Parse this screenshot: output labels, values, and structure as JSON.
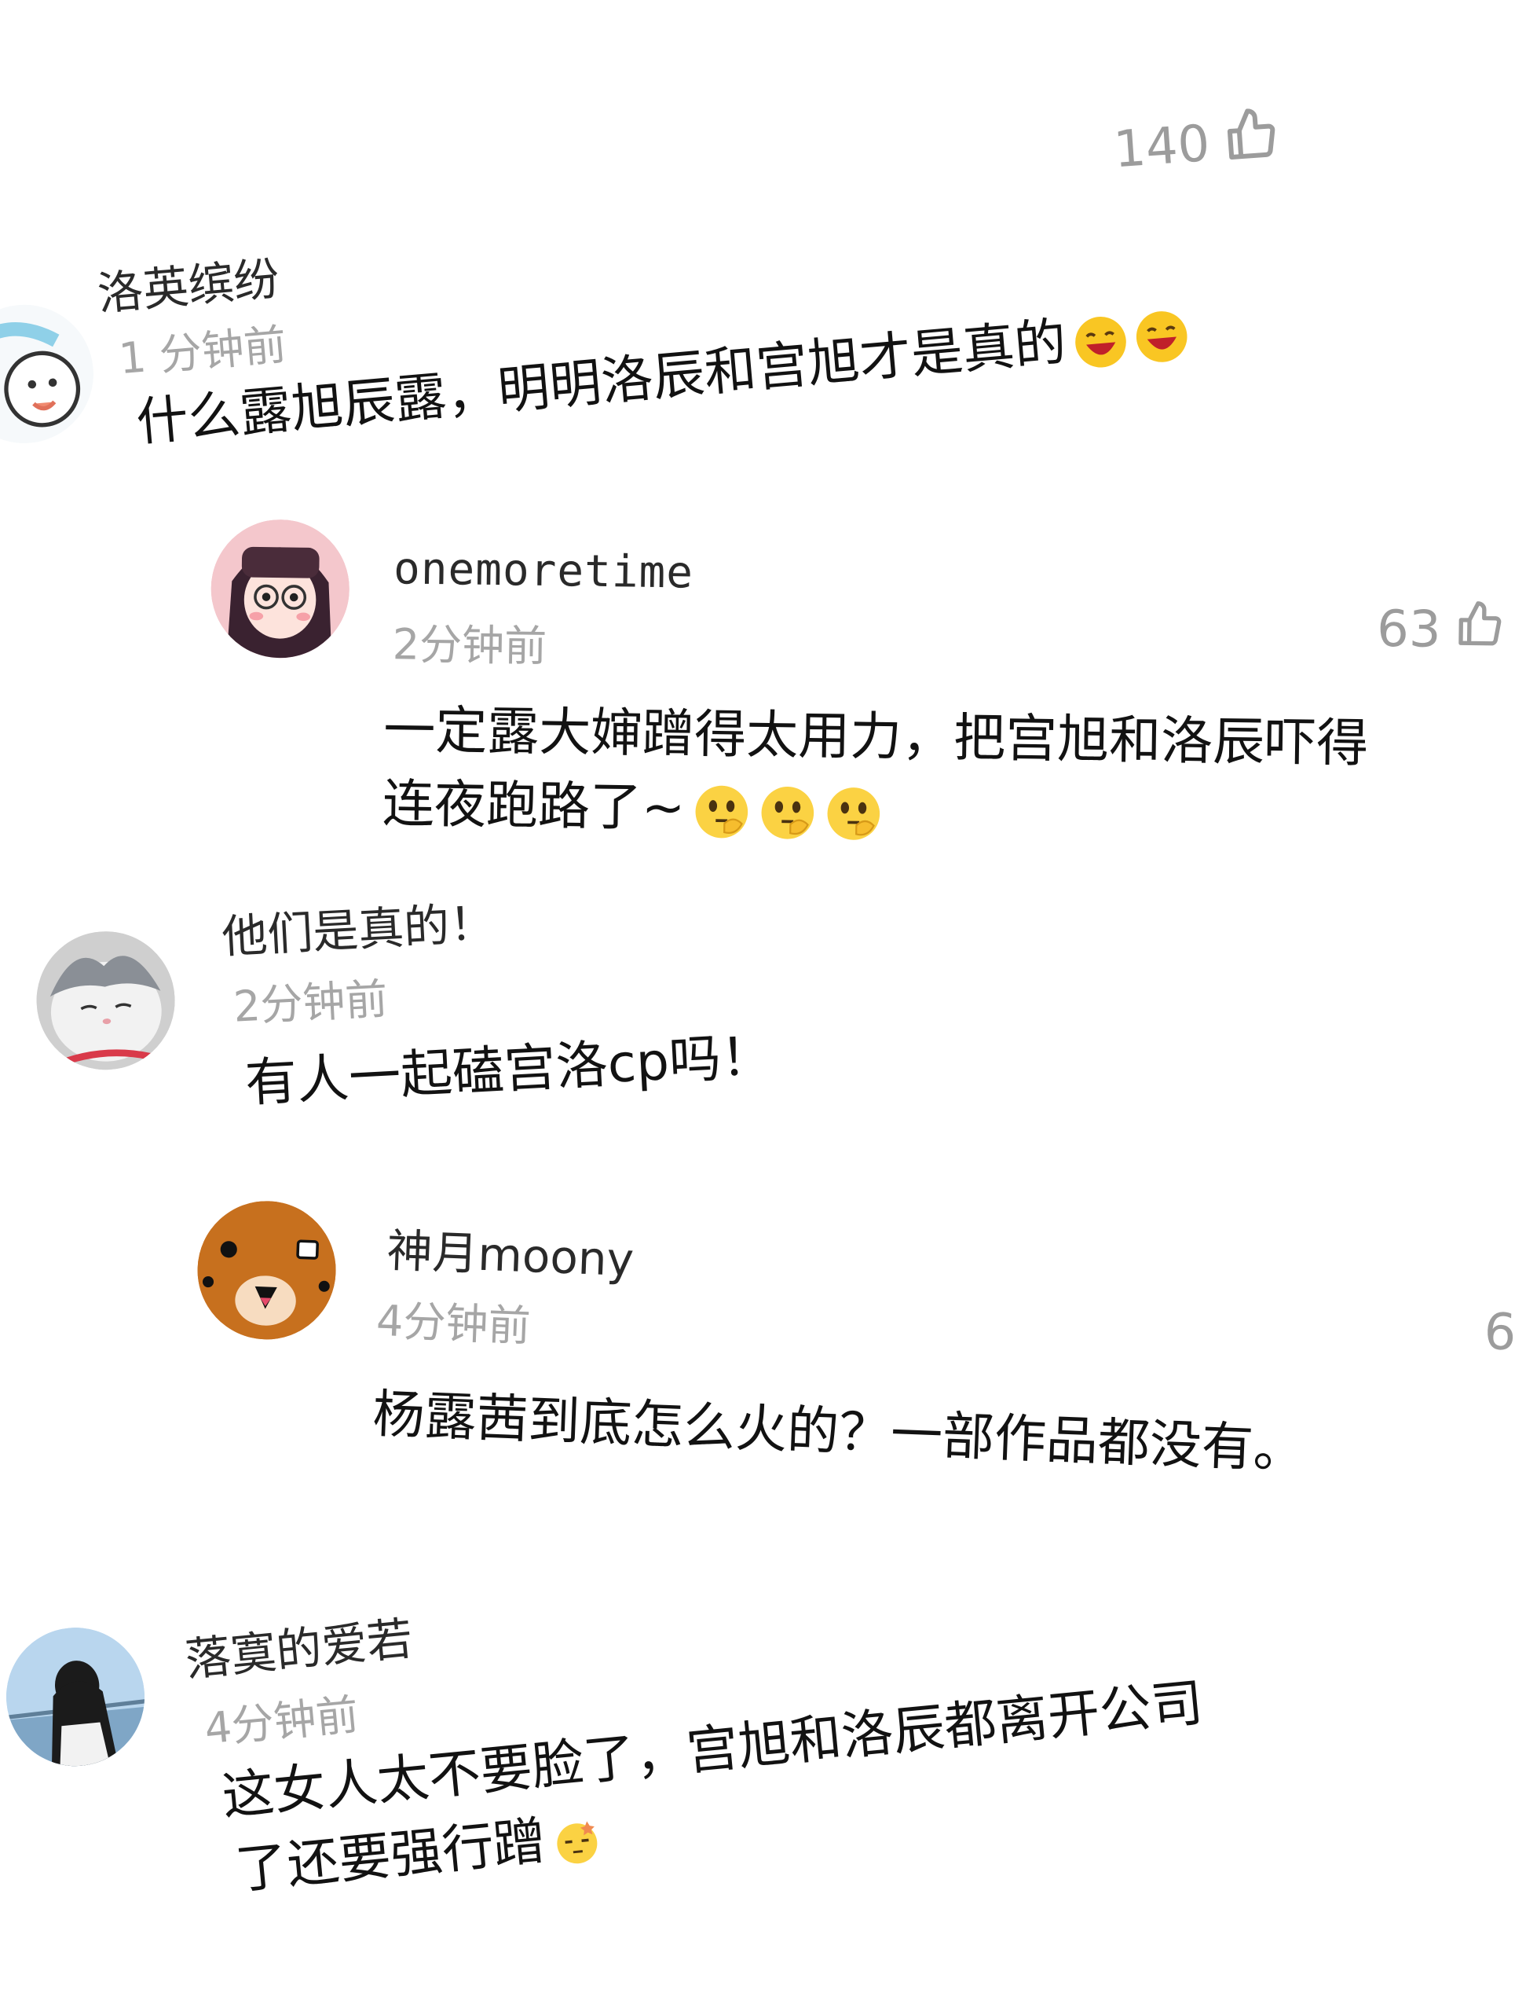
{
  "top": {
    "likes": "140"
  },
  "comments": [
    {
      "username": "洛英缤纷",
      "time": "1 分钟前",
      "text": "什么露旭辰露，明明洛辰和宫旭才是真的",
      "emojis": [
        "laughing-emoji",
        "laughing-emoji"
      ]
    },
    {
      "username": "onemoretime",
      "time": "2分钟前",
      "likes": "63",
      "text_line1": "一定露大婶蹭得太用力，把宫旭和洛辰吓得",
      "text_line2": "连夜跑路了~",
      "emojis": [
        "thinking-emoji",
        "thinking-emoji",
        "thinking-emoji"
      ]
    },
    {
      "username": "他们是真的！",
      "time": "2分钟前",
      "text": "有人一起磕宫洛cp吗！"
    },
    {
      "username": "神月moony",
      "time": "4分钟前",
      "likes": "6",
      "text": "杨露茜到底怎么火的？一部作品都没有。"
    },
    {
      "username": "落寞的爱若",
      "time": "4分钟前",
      "text_line1": "这女人太不要脸了，宫旭和洛辰都离开公司",
      "text_line2": "了还要强行蹭",
      "emojis": [
        "dizzy-emoji"
      ]
    }
  ],
  "colors": {
    "text": "#121212",
    "username": "#2a2a2a",
    "time": "#a6a6a6",
    "likes": "#9c9c9c",
    "background": "#ffffff"
  },
  "icons": {
    "like": "thumbs-up-outline-icon"
  }
}
